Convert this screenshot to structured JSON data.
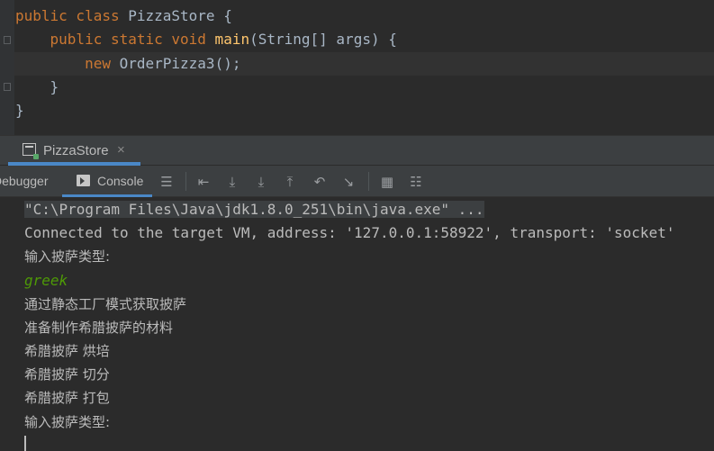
{
  "editor": {
    "lines": [
      {
        "kw1": "public class",
        "text": " PizzaStore {"
      },
      {
        "indent": "    ",
        "kw1": "public static void",
        "fn": " main",
        "text": "(String[] args) {"
      },
      {
        "indent": "        ",
        "kw1": "new",
        "text": " OrderPizza3();"
      },
      {
        "indent": "    ",
        "text": "}"
      },
      {
        "text": "}"
      }
    ]
  },
  "run_panel": {
    "tab_label": "PizzaStore",
    "tab_close": "×"
  },
  "toolbar": {
    "debugger_label": "Debugger",
    "console_label": "Console"
  },
  "console": {
    "command": "\"C:\\Program Files\\Java\\jdk1.8.0_251\\bin\\java.exe\" ...",
    "connected": "Connected to the target VM, address: '127.0.0.1:58922', transport: 'socket'",
    "prompt1": "输入披萨类型:",
    "input": "greek",
    "out1": "通过静态工厂模式获取披萨",
    "out2": "准备制作希腊披萨的材料",
    "out3": "希腊披萨 烘培",
    "out4": "希腊披萨 切分",
    "out5": "希腊披萨 打包",
    "prompt2": "输入披萨类型:"
  },
  "colors": {
    "keyword": "#cc7832",
    "method": "#ffc66d",
    "user_input": "#4e9a06",
    "accent": "#4a88c7"
  }
}
